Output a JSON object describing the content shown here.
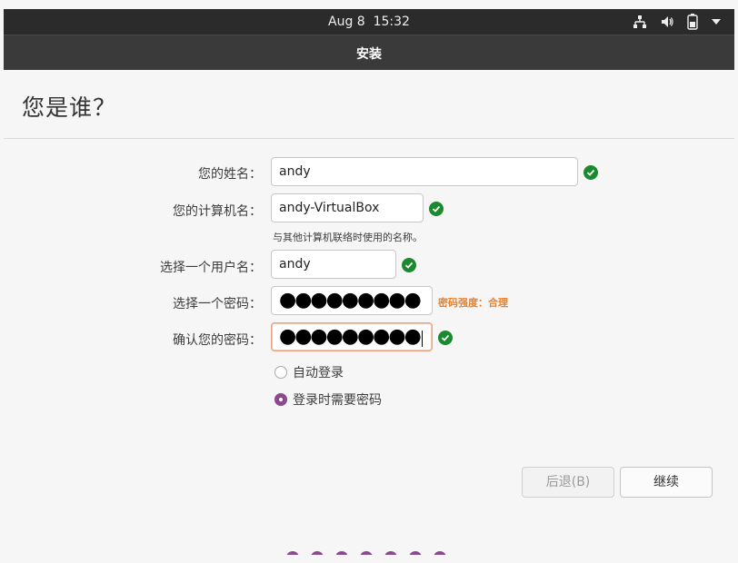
{
  "topbar": {
    "clock": "Aug 8  15:32",
    "icons": [
      "network-icon",
      "volume-icon",
      "battery-icon",
      "menu-chevron-down-icon"
    ]
  },
  "window": {
    "title": "安装"
  },
  "page": {
    "heading": "您是谁？"
  },
  "form": {
    "name_label": "您的姓名：",
    "name_value": "andy",
    "computer_label": "您的计算机名：",
    "computer_value": "andy-VirtualBox",
    "computer_hint": "与其他计算机联络时使用的名称。",
    "username_label": "选择一个用户名：",
    "username_value": "andy",
    "password_label": "选择一个密码：",
    "password_mask": "●●●●●●●●●",
    "password_strength": "密码强度：合理",
    "confirm_label": "确认您的密码：",
    "confirm_mask": "●●●●●●●●●"
  },
  "login_options": {
    "auto_login": "自动登录",
    "require_password": "登录时需要密码",
    "selected": "require_password"
  },
  "buttons": {
    "back": "后退(B)",
    "continue": "继续"
  },
  "colors": {
    "accent": "#8b4a8d",
    "valid": "#1b8a2e",
    "strength": "#e8812c",
    "focus_border": "#e9a07f",
    "topbar": "#2b2b2b",
    "titlebar": "#3a3a3a"
  }
}
